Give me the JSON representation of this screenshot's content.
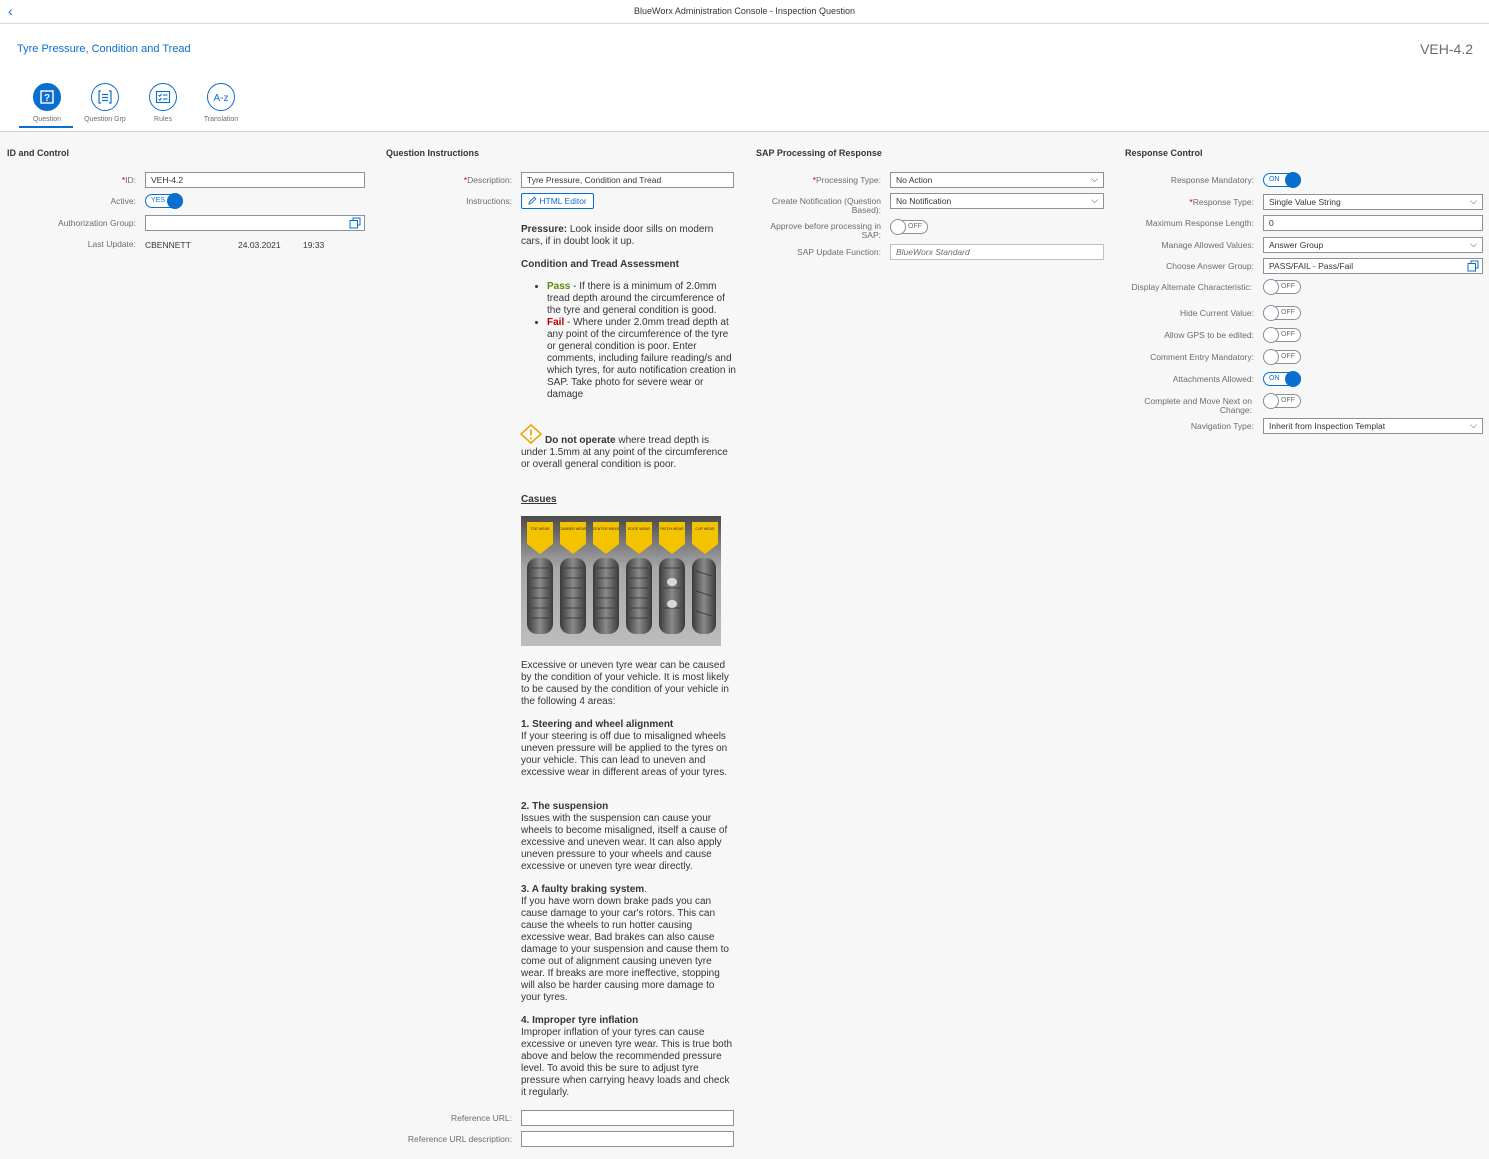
{
  "shell": {
    "title": "BlueWorx Administration Console - Inspection Question"
  },
  "header": {
    "title": "Tyre Pressure, Condition and Tread",
    "object_id": "VEH-4.2"
  },
  "tabs": [
    {
      "label": "Question",
      "icon": "question-icon",
      "active": true
    },
    {
      "label": "Question Grp",
      "icon": "list-icon",
      "active": false
    },
    {
      "label": "Rules",
      "icon": "checklist-icon",
      "active": false
    },
    {
      "label": "Translation",
      "icon": "a-z-icon",
      "active": false
    }
  ],
  "id_control": {
    "title": "ID and Control",
    "id_label": "ID:",
    "id_value": "VEH-4.2",
    "active_label": "Active:",
    "active_value": "YES",
    "auth_label": "Authorization Group:",
    "auth_value": "",
    "update_label": "Last Update:",
    "update_user": "CBENNETT",
    "update_date": "24.03.2021",
    "update_time": "19:33"
  },
  "instructions": {
    "title": "Question Instructions",
    "desc_label": "Description:",
    "desc_value": "Tyre Pressure, Condition and Tread",
    "instr_label": "Instructions:",
    "html_editor": "HTML Editor",
    "pressure_b": "Pressure:",
    "pressure_t": " Look inside door sills on modern cars, if in doubt look it up.",
    "cond_heading": "Condition and Tread Assessment",
    "pass_w": "Pass",
    "pass_t": " - If there is a minimum of 2.0mm tread depth around the circumference of the tyre and general condition is good.",
    "fail_w": "Fail",
    "fail_t": " - Where under 2.0mm tread depth at any point of the circumference of the tyre or general condition is poor. Enter comments, including failure reading/s and which tyres, for auto notification creation in SAP. Take photo for severe wear or damage",
    "warn_b": "Do not operate",
    "warn_t": " where tread depth is under 1.5mm at any point of the circumference or overall general condition is poor.",
    "causes_heading": "Casues",
    "tyre_labels": [
      "TOE WEAR",
      "CAMBER WEAR",
      "CENTER WEAR",
      "EDGE WEAR",
      "PATCH WEAR",
      "CUP WEAR"
    ],
    "intro": "Excessive or uneven tyre wear can be caused by the condition of your vehicle. It is most likely to be caused by the condition of your vehicle in the following 4 areas:",
    "c1_h": "1. Steering and wheel alignment",
    "c1_t": "If your steering is off due to misaligned wheels uneven pressure will be applied to the tyres on your vehicle. This can lead to uneven and excessive wear in different areas of your tyres.",
    "c2_h": "2. The suspension",
    "c2_t": "Issues with the suspension can cause your wheels to become misaligned, itself a cause of excessive and uneven wear. It can also apply uneven pressure to your wheels and cause excessive or uneven tyre wear directly.",
    "c3_h": "3. A faulty braking system",
    "c3_dot": ".",
    "c3_t": "If you have worn down brake pads you can cause damage to your car's rotors. This can cause the wheels to run hotter causing excessive wear. Bad brakes can also cause damage to your suspension and cause them to come out of alignment causing uneven tyre wear. If breaks are more ineffective, stopping will also be harder causing more damage to your tyres.",
    "c4_h": "4. Improper tyre inflation",
    "c4_t": "Improper inflation of your tyres can cause excessive or uneven tyre wear. This is true both above and below the recommended pressure level. To avoid this be sure to adjust tyre pressure when carrying heavy loads and check it regularly.",
    "ref_url_label": "Reference URL:",
    "ref_url_value": "",
    "ref_desc_label": "Reference URL description:",
    "ref_desc_value": ""
  },
  "sap": {
    "title": "SAP Processing of Response",
    "proc_label": "Processing Type:",
    "proc_value": "No Action",
    "notif_label": "Create Notification (Question Based):",
    "notif_value": "No Notification",
    "approve_label": "Approve before processing in SAP:",
    "approve_value": "OFF",
    "func_label": "SAP Update Function:",
    "func_value": "BlueWorx Standard"
  },
  "response": {
    "title": "Response Control",
    "mandatory_label": "Response Mandatory:",
    "mandatory_value": "ON",
    "type_label": "Response Type:",
    "type_value": "Single Value String",
    "maxlen_label": "Maximum Response Length:",
    "maxlen_value": "0",
    "manage_label": "Manage Allowed Values:",
    "manage_value": "Answer Group",
    "group_label": "Choose Answer Group:",
    "group_value": "PASS/FAIL - Pass/Fail",
    "alt_label": "Display Alternate Characteristic:",
    "alt_value": "OFF",
    "hide_label": "Hide Current Value:",
    "hide_value": "OFF",
    "gps_label": "Allow GPS to be edited:",
    "gps_value": "OFF",
    "comment_label": "Comment Entry Mandatory:",
    "comment_value": "OFF",
    "attach_label": "Attachments Allowed:",
    "attach_value": "ON",
    "complete_label": "Complete and Move Next on Change:",
    "complete_value": "OFF",
    "nav_label": "Navigation Type:",
    "nav_value": "Inherit from Inspection Templat"
  },
  "colors": {
    "accent": "#0a6ed1",
    "required": "#bb0000",
    "pass": "#5b8a08",
    "warning": "#e9a400"
  }
}
